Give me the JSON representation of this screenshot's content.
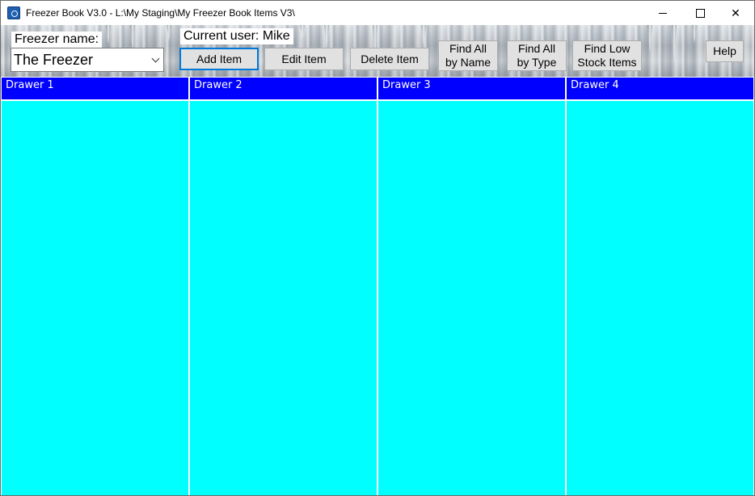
{
  "window": {
    "title": "Freezer Book V3.0 - L:\\My Staging\\My Freezer Book Items V3\\",
    "controls": [
      "minimize",
      "maximize",
      "close"
    ]
  },
  "toolbar": {
    "freezer_label": "Freezer name:",
    "freezer_selected": "The Freezer",
    "current_user": "Current user: Mike",
    "buttons": {
      "add": "Add Item",
      "edit": "Edit Item",
      "delete": "Delete Item",
      "find_name_l1": "Find All",
      "find_name_l2": "by Name",
      "find_type_l1": "Find All",
      "find_type_l2": "by Type",
      "find_low_l1": "Find Low",
      "find_low_l2": "Stock Items",
      "help": "Help"
    }
  },
  "drawers": [
    {
      "name": "Drawer 1",
      "items": []
    },
    {
      "name": "Drawer 2",
      "items": []
    },
    {
      "name": "Drawer 3",
      "items": []
    },
    {
      "name": "Drawer 4",
      "items": []
    }
  ],
  "colors": {
    "header_bg": "#0000ff",
    "header_text": "#ffffff",
    "drawer_bg": "#00ffff",
    "button_face": "#e1e1e1",
    "focus_border": "#0078d7"
  },
  "icons": {
    "app": "snowflake-app-icon",
    "combo": "chevron-down-icon"
  }
}
